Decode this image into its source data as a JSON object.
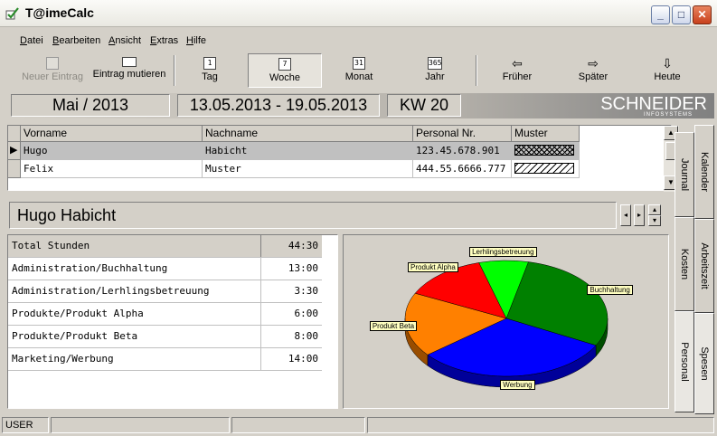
{
  "window": {
    "title": "T@imeCalc"
  },
  "menu": [
    "Datei",
    "Bearbeiten",
    "Ansicht",
    "Extras",
    "Hilfe"
  ],
  "toolbar": {
    "new_entry": "Neuer Eintrag",
    "edit_entry": "Eintrag mutieren",
    "day": "Tag",
    "day_icon_num": "1",
    "week": "Woche",
    "week_icon_num": "7",
    "month": "Monat",
    "month_icon_num": "31",
    "year": "Jahr",
    "year_icon_num": "365",
    "earlier": "Früher",
    "later": "Später",
    "today": "Heute"
  },
  "header": {
    "month": "Mai / 2013",
    "range": "13.05.2013 - 19.05.2013",
    "week": "KW 20",
    "logo": "SCHNEIDER",
    "logo_sub": "INFOSYSTEMS"
  },
  "people": {
    "columns": [
      "Vorname",
      "Nachname",
      "Personal Nr.",
      "Muster"
    ],
    "rows": [
      {
        "first": "Hugo",
        "last": "Habicht",
        "number": "123.45.678.901",
        "pattern": "cross"
      },
      {
        "first": "Felix",
        "last": "Muster",
        "number": "444.55.6666.777",
        "pattern": "diagonal"
      }
    ]
  },
  "selected_name": "Hugo Habicht",
  "hours": {
    "total_label": "Total Stunden",
    "total_value": "44:30",
    "rows": [
      {
        "label": "Administration/Buchhaltung",
        "value": "13:00"
      },
      {
        "label": "Administration/Lerhlingsbetreuung",
        "value": "3:30"
      },
      {
        "label": "Produkte/Produkt Alpha",
        "value": "6:00"
      },
      {
        "label": "Produkte/Produkt Beta",
        "value": "8:00"
      },
      {
        "label": "Marketing/Werbung",
        "value": "14:00"
      }
    ]
  },
  "pie": {
    "slices": [
      {
        "label": "Buchhaltung",
        "hours": 13.0,
        "color": "#008000"
      },
      {
        "label": "Werbung",
        "hours": 14.0,
        "color": "#0000ff"
      },
      {
        "label": "Produkt Beta",
        "hours": 8.0,
        "color": "#ff8000"
      },
      {
        "label": "Produkt Alpha",
        "hours": 6.0,
        "color": "#ff0000"
      },
      {
        "label": "Lerhlingsbetreuung",
        "hours": 3.5,
        "color": "#00ff00"
      }
    ]
  },
  "tabs_outer": [
    "Kalender",
    "Arbeitszeit",
    "Spesen"
  ],
  "tabs_inner": [
    "Journal",
    "Kosten",
    "Personal"
  ],
  "status": {
    "user": "USER"
  }
}
